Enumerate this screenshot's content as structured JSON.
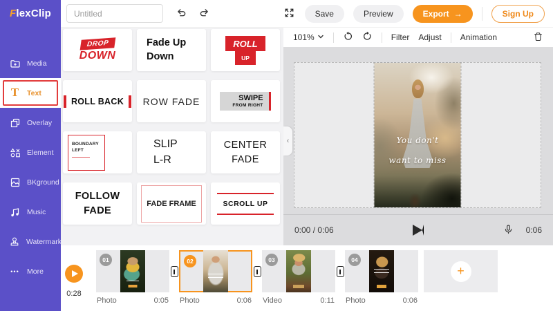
{
  "topbar": {
    "logo": "FlexClip",
    "title_placeholder": "Untitled",
    "save": "Save",
    "preview": "Preview",
    "export": "Export",
    "export_arrow": "→",
    "signup": "Sign Up"
  },
  "sidebar": {
    "items": [
      {
        "id": "media",
        "label": "Media",
        "icon": "folder-plus-icon",
        "active": false
      },
      {
        "id": "text",
        "label": "Text",
        "icon": "text-t-icon",
        "active": true
      },
      {
        "id": "overlay",
        "label": "Overlay",
        "icon": "overlay-icon",
        "active": false
      },
      {
        "id": "element",
        "label": "Element",
        "icon": "shapes-icon",
        "active": false
      },
      {
        "id": "bkground",
        "label": "BKground",
        "icon": "background-icon",
        "active": false
      },
      {
        "id": "music",
        "label": "Music",
        "icon": "music-note-icon",
        "active": false
      },
      {
        "id": "watermark",
        "label": "Watermark",
        "icon": "stamp-icon",
        "active": false
      },
      {
        "id": "more",
        "label": "More",
        "icon": "ellipsis-icon",
        "active": false
      }
    ]
  },
  "presets": {
    "items": [
      {
        "id": "drop-down",
        "variant": "drop-down",
        "top": "DROP",
        "bottom": "DOWN"
      },
      {
        "id": "fade-up-down",
        "variant": "fade-up-down",
        "lines": [
          "Fade Up",
          "Down"
        ]
      },
      {
        "id": "roll-up",
        "variant": "roll-up",
        "top": "ROLL",
        "bottom": "UP"
      },
      {
        "id": "roll-back",
        "variant": "roll-back",
        "label": "ROLL BACK"
      },
      {
        "id": "row-fade",
        "variant": "row-fade",
        "label": "ROW FADE"
      },
      {
        "id": "swipe-right",
        "variant": "swipe-right",
        "top": "SWIPE",
        "bottom": "FROM RIGHT"
      },
      {
        "id": "boundary-left",
        "variant": "boundary-left",
        "lines": [
          "BOUNDARY",
          "LEFT"
        ]
      },
      {
        "id": "slip-lr",
        "variant": "slip-lr",
        "lines": [
          "SLIP",
          "L-R"
        ]
      },
      {
        "id": "center-fade",
        "variant": "center-fade",
        "lines": [
          "CENTER",
          "FADE"
        ]
      },
      {
        "id": "follow-fade",
        "variant": "follow-fade",
        "lines": [
          "FOLLOW",
          "FADE"
        ]
      },
      {
        "id": "fade-frame",
        "variant": "fade-frame",
        "label": "FADE FRAME"
      },
      {
        "id": "scroll-up",
        "variant": "scroll-up",
        "label": "SCROLL UP"
      }
    ]
  },
  "preview": {
    "zoom": "101%",
    "tabs": [
      "Filter",
      "Adjust",
      "Animation"
    ],
    "overlay_line1": "You don't",
    "overlay_line2": "want to miss",
    "time": "0:00 / 0:06",
    "duration": "0:06"
  },
  "timeline": {
    "total": "0:28",
    "add_label": "+",
    "clips": [
      {
        "num": "01",
        "type": "Photo",
        "duration": "0:05",
        "selected": false,
        "thumb": "thumb-1"
      },
      {
        "num": "02",
        "type": "Photo",
        "duration": "0:06",
        "selected": true,
        "thumb": "thumb-2"
      },
      {
        "num": "03",
        "type": "Video",
        "duration": "0:11",
        "selected": false,
        "thumb": "thumb-3"
      },
      {
        "num": "04",
        "type": "Photo",
        "duration": "0:06",
        "selected": false,
        "thumb": "thumb-4"
      }
    ]
  },
  "glyphs": {
    "collapse_chevron": "‹",
    "more_dots": "•••",
    "text_tab_glyph": "T"
  },
  "colors": {
    "brand_purple": "#5b50c8",
    "accent_orange": "#f7941e",
    "preset_red": "#d8232a",
    "active_tab_border_red": "#e23c3c"
  }
}
